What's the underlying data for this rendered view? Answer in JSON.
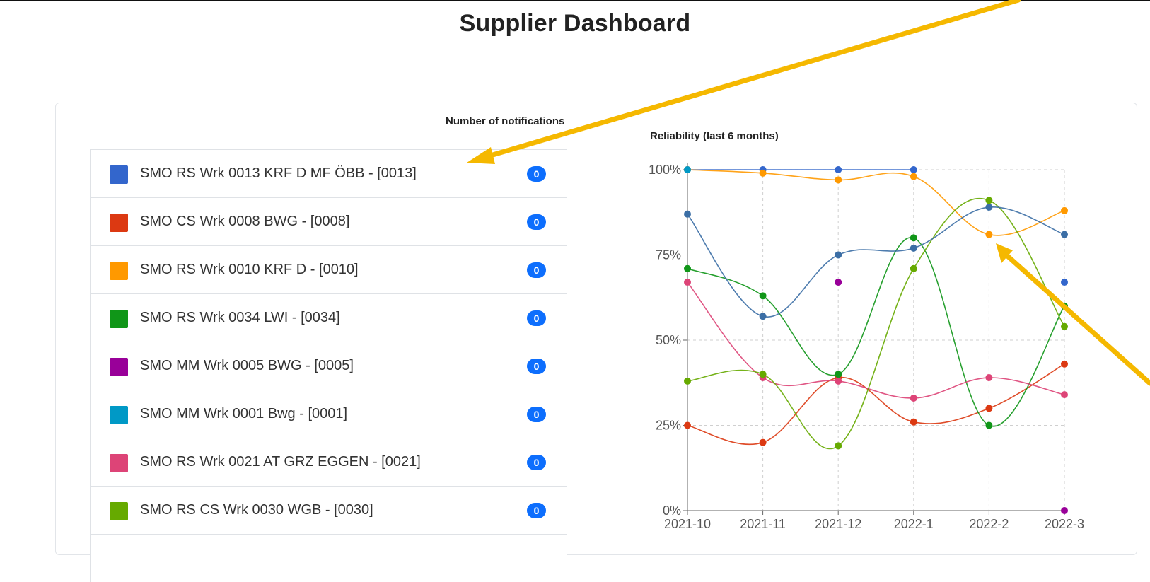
{
  "page": {
    "title": "Supplier Dashboard"
  },
  "notifications": {
    "title": "Number of notifications",
    "items": [
      {
        "label": "SMO RS Wrk 0013 KRF D MF ÖBB - [0013]",
        "count": "0",
        "color": "#3366cc"
      },
      {
        "label": "SMO CS Wrk 0008 BWG - [0008]",
        "count": "0",
        "color": "#dc3912"
      },
      {
        "label": "SMO RS Wrk 0010 KRF D - [0010]",
        "count": "0",
        "color": "#ff9900"
      },
      {
        "label": "SMO RS Wrk 0034 LWI - [0034]",
        "count": "0",
        "color": "#109618"
      },
      {
        "label": "SMO MM Wrk 0005 BWG - [0005]",
        "count": "0",
        "color": "#990099"
      },
      {
        "label": "SMO MM Wrk 0001 Bwg - [0001]",
        "count": "0",
        "color": "#0099c6"
      },
      {
        "label": "SMO RS Wrk 0021 AT GRZ EGGEN - [0021]",
        "count": "0",
        "color": "#dd4477"
      },
      {
        "label": "SMO RS CS Wrk 0030 WGB - [0030]",
        "count": "0",
        "color": "#66aa00"
      }
    ]
  },
  "chart_data": {
    "type": "line",
    "title": "Reliability (last 6 months)",
    "categories": [
      "2021-10",
      "2021-11",
      "2021-12",
      "2022-1",
      "2022-2",
      "2022-3"
    ],
    "yticks": [
      "0%",
      "25%",
      "50%",
      "75%",
      "100%"
    ],
    "ylim": [
      0,
      100
    ],
    "grid": true,
    "series": [
      {
        "color": "#3366cc",
        "values": [
          100,
          100,
          100,
          100,
          null,
          67
        ]
      },
      {
        "color": "#dc3912",
        "values": [
          25,
          20,
          39,
          26,
          30,
          43
        ]
      },
      {
        "color": "#ff9900",
        "values": [
          100,
          99,
          97,
          98,
          81,
          88
        ]
      },
      {
        "color": "#109618",
        "values": [
          71,
          63,
          40,
          80,
          25,
          60
        ]
      },
      {
        "color": "#990099",
        "values": [
          null,
          null,
          67,
          null,
          null,
          0
        ]
      },
      {
        "color": "#0099c6",
        "values": [
          100,
          null,
          null,
          null,
          null,
          null
        ]
      },
      {
        "color": "#dd4477",
        "values": [
          67,
          39,
          38,
          33,
          39,
          34
        ]
      },
      {
        "color": "#66aa00",
        "values": [
          38,
          40,
          19,
          71,
          91,
          54
        ]
      },
      {
        "color": "#3b6ea5",
        "values": [
          87,
          57,
          75,
          77,
          89,
          81
        ]
      }
    ]
  }
}
